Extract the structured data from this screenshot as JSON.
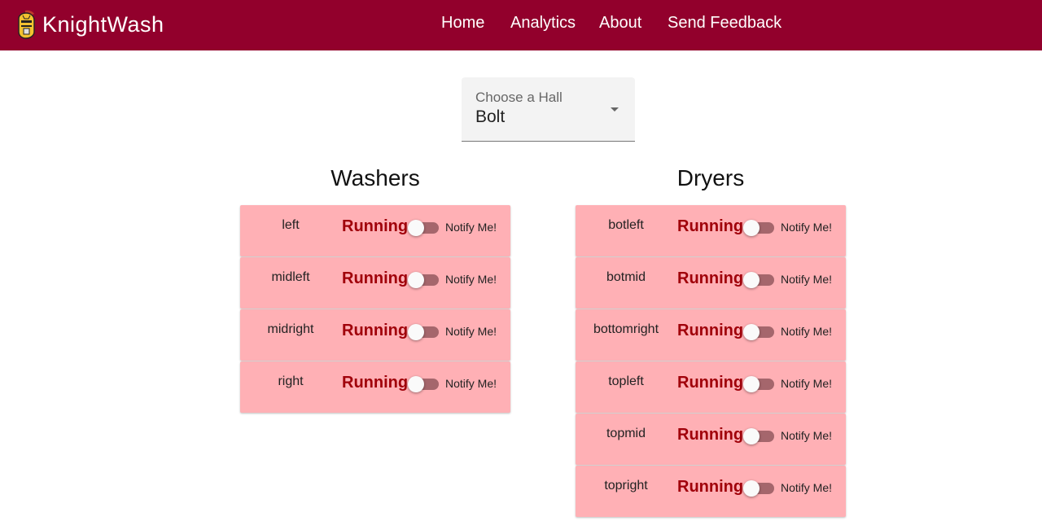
{
  "app": {
    "name": "KnightWash",
    "logo_icon": "knight-helmet-icon",
    "brand_color": "#92002c"
  },
  "nav": {
    "items": [
      {
        "label": "Home"
      },
      {
        "label": "Analytics"
      },
      {
        "label": "About"
      },
      {
        "label": "Send Feedback"
      }
    ]
  },
  "hall_select": {
    "label": "Choose a Hall",
    "value": "Bolt"
  },
  "washers": {
    "title": "Washers",
    "machines": [
      {
        "name": "left",
        "status": "Running",
        "notify_label": "Notify Me!",
        "notify_on": false
      },
      {
        "name": "midleft",
        "status": "Running",
        "notify_label": "Notify Me!",
        "notify_on": false
      },
      {
        "name": "midright",
        "status": "Running",
        "notify_label": "Notify Me!",
        "notify_on": false
      },
      {
        "name": "right",
        "status": "Running",
        "notify_label": "Notify Me!",
        "notify_on": false
      }
    ]
  },
  "dryers": {
    "title": "Dryers",
    "machines": [
      {
        "name": "botleft",
        "status": "Running",
        "notify_label": "Notify Me!",
        "notify_on": false
      },
      {
        "name": "botmid",
        "status": "Running",
        "notify_label": "Notify Me!",
        "notify_on": false
      },
      {
        "name": "bottomright",
        "status": "Running",
        "notify_label": "Notify Me!",
        "notify_on": false
      },
      {
        "name": "topleft",
        "status": "Running",
        "notify_label": "Notify Me!",
        "notify_on": false
      },
      {
        "name": "topmid",
        "status": "Running",
        "notify_label": "Notify Me!",
        "notify_on": false
      },
      {
        "name": "topright",
        "status": "Running",
        "notify_label": "Notify Me!",
        "notify_on": false
      }
    ]
  },
  "colors": {
    "card_background": "#ffb0b5",
    "running_status": "#a0000a"
  }
}
